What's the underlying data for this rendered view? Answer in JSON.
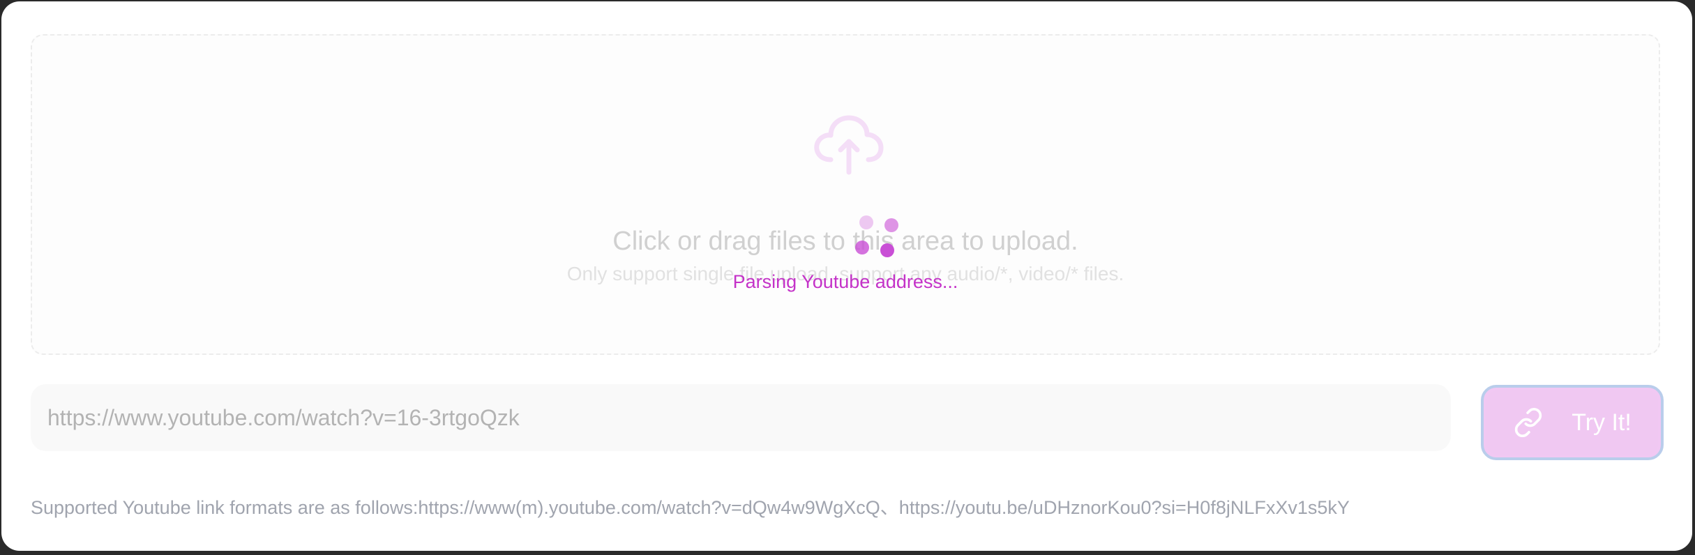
{
  "upload": {
    "title": "Click or drag files to this area to upload.",
    "hint": "Only support single file upload, support any audio/*, video/* files.",
    "icon": "cloud-upload-icon"
  },
  "loading": {
    "text": "Parsing Youtube address..."
  },
  "url_input": {
    "placeholder": "https://www.youtube.com/watch?v=16-3rtgoQzk",
    "value": ""
  },
  "try_button": {
    "label": "Try It!",
    "icon": "link-icon"
  },
  "supported": {
    "text": "Supported Youtube link formats are as follows:https://www(m).youtube.com/watch?v=dQw4w9WgXcQ、https://youtu.be/uDHznorKou0?si=H0f8jNLFxXv1s5kY"
  },
  "colors": {
    "accent": "#c432c8",
    "button_bg": "#f0c8f2",
    "button_border": "#b9cdeb"
  }
}
